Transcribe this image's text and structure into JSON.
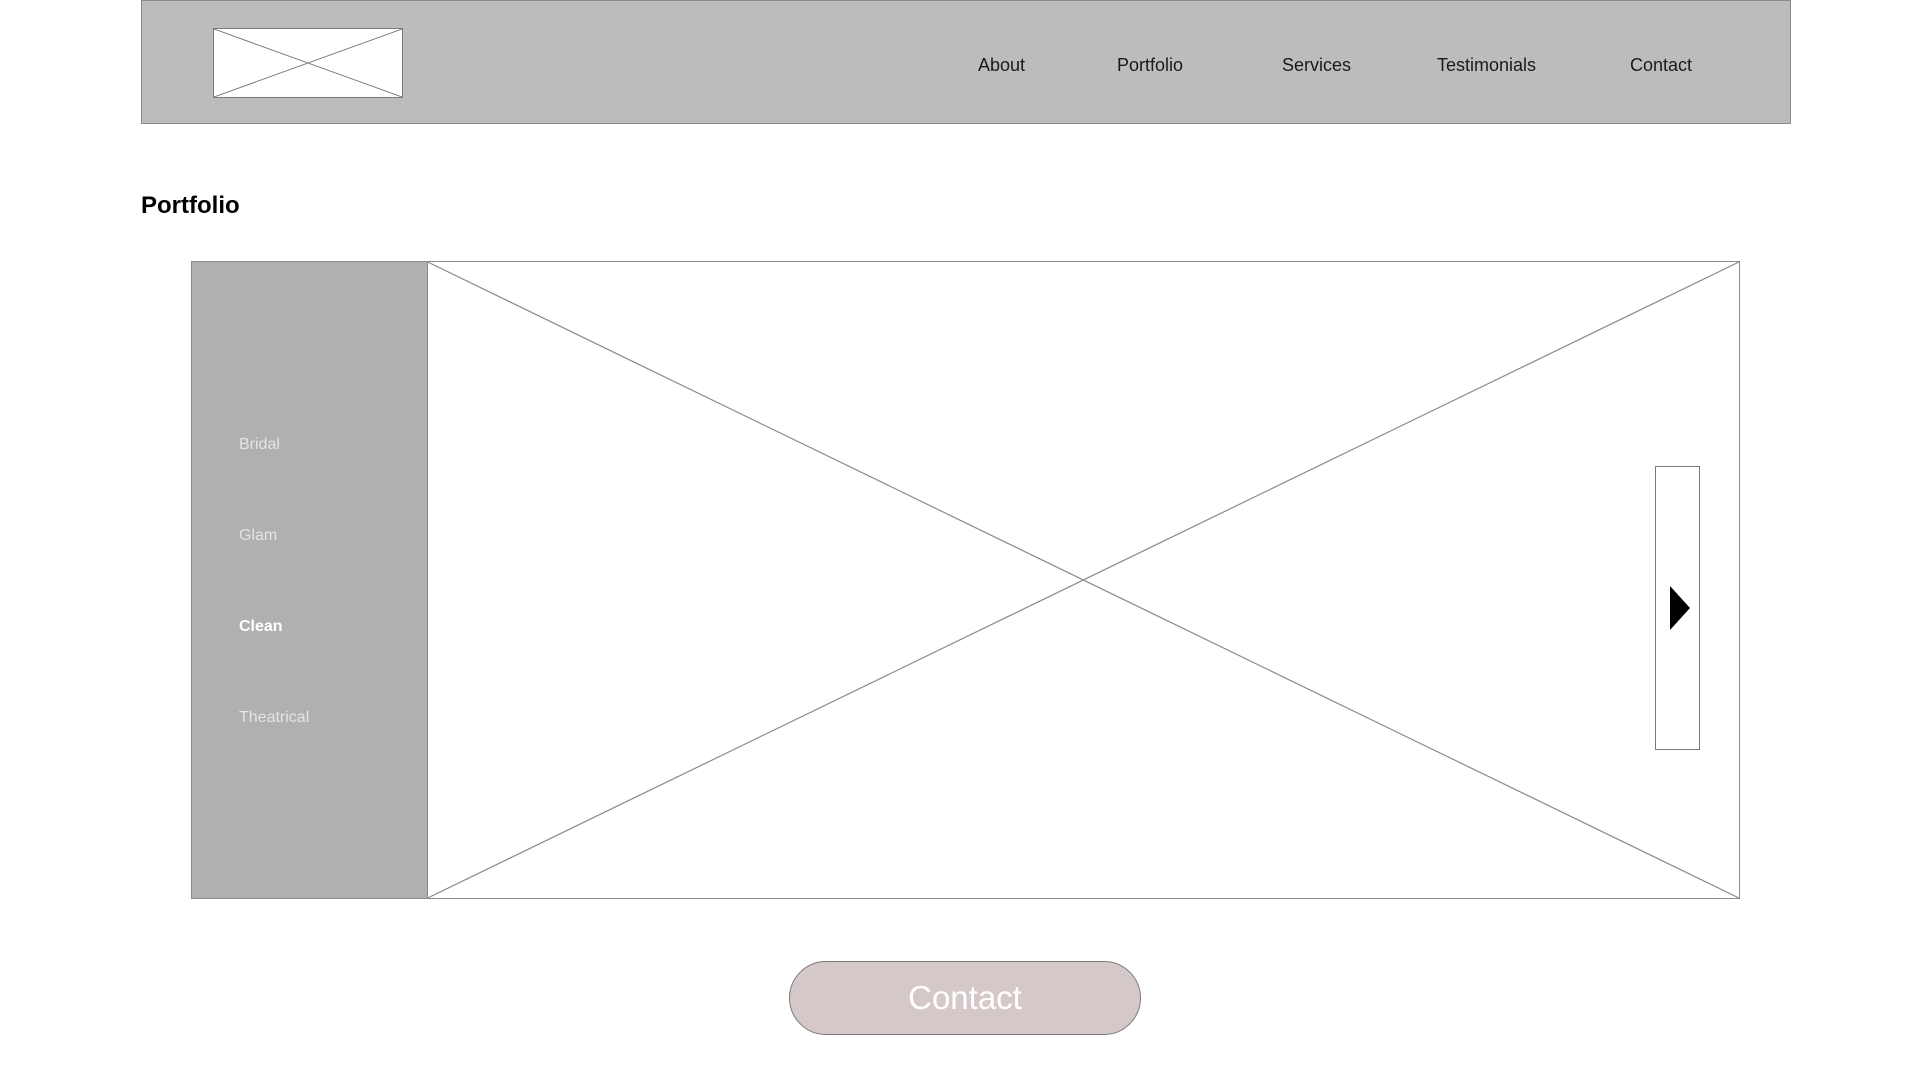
{
  "header": {
    "nav": [
      {
        "id": "about",
        "label": "About"
      },
      {
        "id": "portfolio",
        "label": "Portfolio"
      },
      {
        "id": "services",
        "label": "Services"
      },
      {
        "id": "testimonials",
        "label": "Testimonials"
      },
      {
        "id": "contact",
        "label": "Contact"
      }
    ]
  },
  "main": {
    "title": "Portfolio",
    "categories": [
      {
        "label": "Bridal",
        "active": false
      },
      {
        "label": "Glam",
        "active": false
      },
      {
        "label": "Clean",
        "active": true
      },
      {
        "label": "Theatrical",
        "active": false
      }
    ],
    "next_icon": "play-arrow-right-icon"
  },
  "footer": {
    "contact_label": "Contact"
  },
  "colors": {
    "header_bg": "#bdbcbb",
    "sidebar_bg": "#b0b0b0",
    "button_bg": "#d4c8c8",
    "active_text": "#ffffff",
    "inactive_text": "#e4e4e4"
  }
}
